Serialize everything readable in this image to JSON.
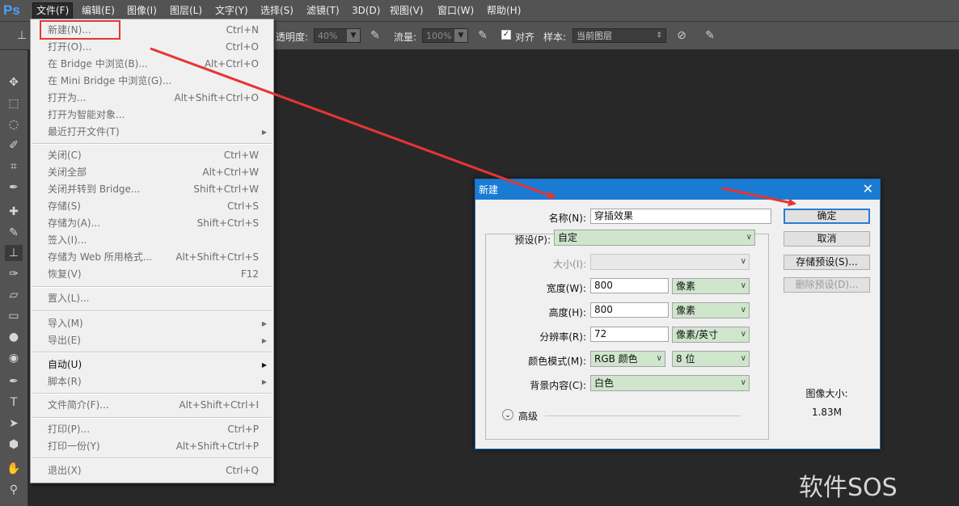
{
  "app": {
    "logo": "Ps"
  },
  "menubar": [
    {
      "label": "文件(F)",
      "active": true
    },
    {
      "label": "编辑(E)"
    },
    {
      "label": "图像(I)"
    },
    {
      "label": "图层(L)"
    },
    {
      "label": "文字(Y)"
    },
    {
      "label": "选择(S)"
    },
    {
      "label": "滤镜(T)"
    },
    {
      "label": "3D(D)"
    },
    {
      "label": "视图(V)"
    },
    {
      "label": "窗口(W)"
    },
    {
      "label": "帮助(H)"
    }
  ],
  "options": {
    "opacity_label": "透明度:",
    "opacity_value": "40%",
    "flow_label": "流量:",
    "flow_value": "100%",
    "align_label": "对齐",
    "align_checked": true,
    "sample_label": "样本:",
    "sample_value": "当前图层"
  },
  "file_menu": {
    "items": [
      {
        "label": "新建(N)...",
        "shortcut": "Ctrl+N",
        "enabled": false
      },
      {
        "label": "打开(O)...",
        "shortcut": "Ctrl+O",
        "enabled": false
      },
      {
        "label": "在 Bridge 中浏览(B)...",
        "shortcut": "Alt+Ctrl+O",
        "enabled": false
      },
      {
        "label": "在 Mini Bridge 中浏览(G)...",
        "shortcut": "",
        "enabled": false
      },
      {
        "label": "打开为...",
        "shortcut": "Alt+Shift+Ctrl+O",
        "enabled": false
      },
      {
        "label": "打开为智能对象...",
        "shortcut": "",
        "enabled": false
      },
      {
        "label": "最近打开文件(T)",
        "shortcut": "",
        "submenu": true,
        "enabled": false
      },
      {
        "label": "关闭(C)",
        "shortcut": "Ctrl+W",
        "enabled": false
      },
      {
        "label": "关闭全部",
        "shortcut": "Alt+Ctrl+W",
        "enabled": false
      },
      {
        "label": "关闭并转到 Bridge...",
        "shortcut": "Shift+Ctrl+W",
        "enabled": false
      },
      {
        "label": "存储(S)",
        "shortcut": "Ctrl+S",
        "enabled": false
      },
      {
        "label": "存储为(A)...",
        "shortcut": "Shift+Ctrl+S",
        "enabled": false
      },
      {
        "label": "签入(I)...",
        "shortcut": "",
        "enabled": false
      },
      {
        "label": "存储为 Web 所用格式...",
        "shortcut": "Alt+Shift+Ctrl+S",
        "enabled": false
      },
      {
        "label": "恢复(V)",
        "shortcut": "F12",
        "enabled": false
      },
      {
        "label": "置入(L)...",
        "shortcut": "",
        "enabled": false
      },
      {
        "label": "导入(M)",
        "shortcut": "",
        "submenu": true,
        "enabled": false
      },
      {
        "label": "导出(E)",
        "shortcut": "",
        "submenu": true,
        "enabled": false
      },
      {
        "label": "自动(U)",
        "shortcut": "",
        "submenu": true,
        "enabled": true
      },
      {
        "label": "脚本(R)",
        "shortcut": "",
        "submenu": true,
        "enabled": false
      },
      {
        "label": "文件简介(F)...",
        "shortcut": "Alt+Shift+Ctrl+I",
        "enabled": false
      },
      {
        "label": "打印(P)...",
        "shortcut": "Ctrl+P",
        "enabled": false
      },
      {
        "label": "打印一份(Y)",
        "shortcut": "Alt+Shift+Ctrl+P",
        "enabled": false
      },
      {
        "label": "退出(X)",
        "shortcut": "Ctrl+Q",
        "enabled": false
      }
    ]
  },
  "dialog": {
    "title": "新建",
    "close": "✕",
    "name_label": "名称(N):",
    "name_value": "穿插效果",
    "preset_label": "预设(P):",
    "preset_value": "自定",
    "size_label": "大小(I):",
    "size_value": "",
    "width_label": "宽度(W):",
    "width_value": "800",
    "width_unit": "像素",
    "height_label": "高度(H):",
    "height_value": "800",
    "height_unit": "像素",
    "resolution_label": "分辨率(R):",
    "resolution_value": "72",
    "resolution_unit": "像素/英寸",
    "color_mode_label": "颜色模式(M):",
    "color_mode_value": "RGB 颜色",
    "bit_depth_value": "8 位",
    "background_label": "背景内容(C):",
    "background_value": "白色",
    "advanced_label": "高级",
    "ok_label": "确定",
    "cancel_label": "取消",
    "save_preset_label": "存储预设(S)...",
    "delete_preset_label": "删除预设(D)...",
    "image_size_label": "图像大小:",
    "image_size_value": "1.83M"
  },
  "watermark": "软件SOS",
  "colors": {
    "accent": "#1a7bd3",
    "highlight": "#e53535",
    "field_green": "#cfe6cd"
  }
}
